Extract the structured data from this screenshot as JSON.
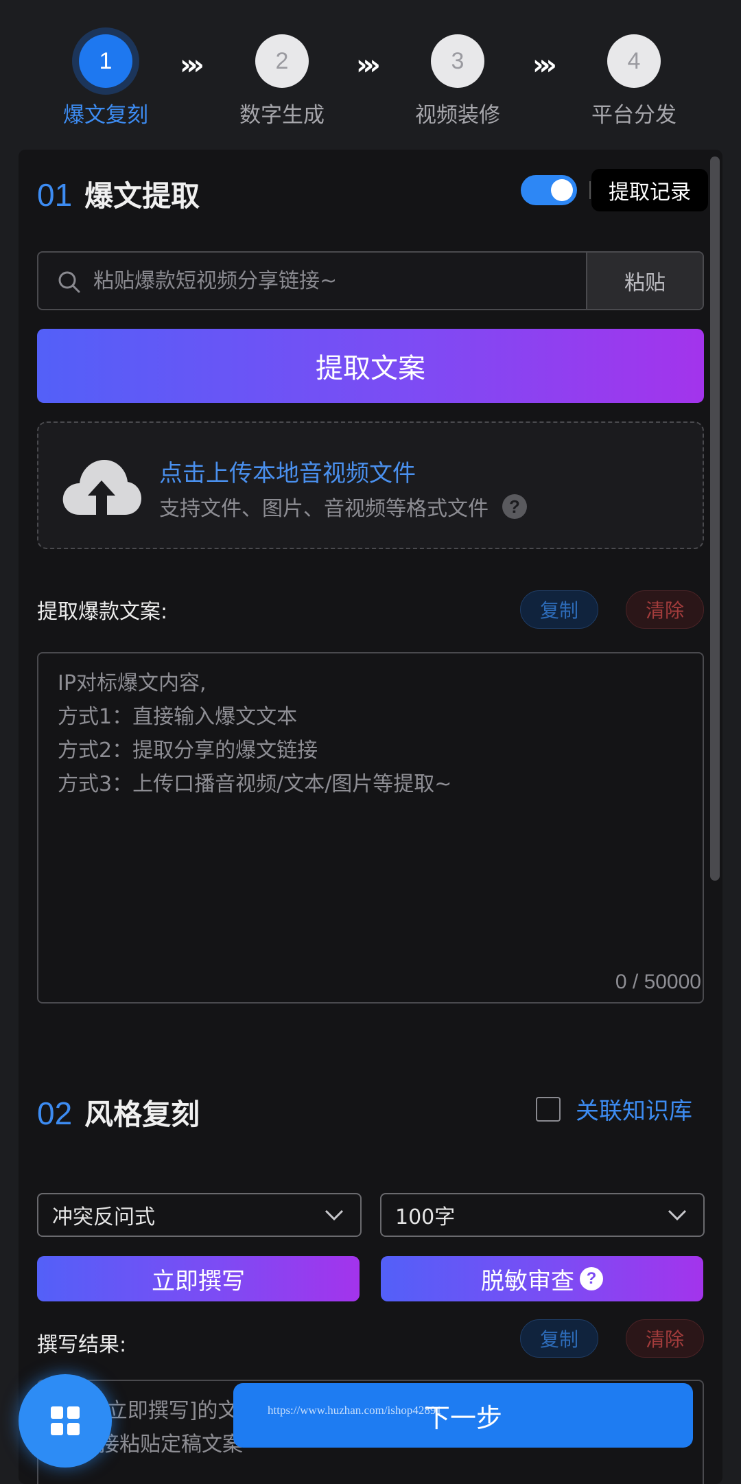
{
  "stepper": {
    "steps": [
      {
        "number": "1",
        "label": "爆文复刻",
        "active": true
      },
      {
        "number": "2",
        "label": "数字生成",
        "active": false
      },
      {
        "number": "3",
        "label": "视频装修",
        "active": false
      },
      {
        "number": "4",
        "label": "平台分发",
        "active": false
      }
    ],
    "separator": "»"
  },
  "section1": {
    "number": "01",
    "title": "爆文提取",
    "toggle_on": true,
    "record_button": "提取记录",
    "search": {
      "placeholder": "粘贴爆款短视频分享链接~",
      "value": ""
    },
    "paste_button": "粘贴",
    "extract_button": "提取文案",
    "upload": {
      "title": "点击上传本地音视频文件",
      "subtitle": "支持文件、图片、音视频等格式文件",
      "help": "?"
    },
    "copy_label": "提取爆款文案:",
    "copy_button": "复制",
    "clear_button": "清除",
    "textarea_lines": [
      "IP对标爆文内容,",
      "方式1：直接输入爆文文本",
      "方式2：提取分享的爆文链接",
      "方式3：上传口播音视频/文本/图片等提取~"
    ],
    "counter": "0 / 50000"
  },
  "section2": {
    "number": "02",
    "title": "风格复刻",
    "kb_checked": false,
    "kb_label": "关联知识库",
    "style_select": "冲突反问式",
    "length_select": "100字",
    "write_button": "立即撰写",
    "desens_button": "脱敏审查",
    "desens_help": "?",
    "result_label": "撰写结果:",
    "copy_button": "复制",
    "clear_button": "清除",
    "result_lines": [
      "点击[立即撰写]的文",
      "或直接粘贴定稿文案"
    ]
  },
  "footer": {
    "next_button": "下一步",
    "watermark": "https://www.huzhan.com/ishop42891"
  },
  "colors": {
    "accent": "#1e78f0",
    "gradient_start": "#5360f8",
    "gradient_end": "#a334ec",
    "clear_red": "#a33c3c"
  }
}
